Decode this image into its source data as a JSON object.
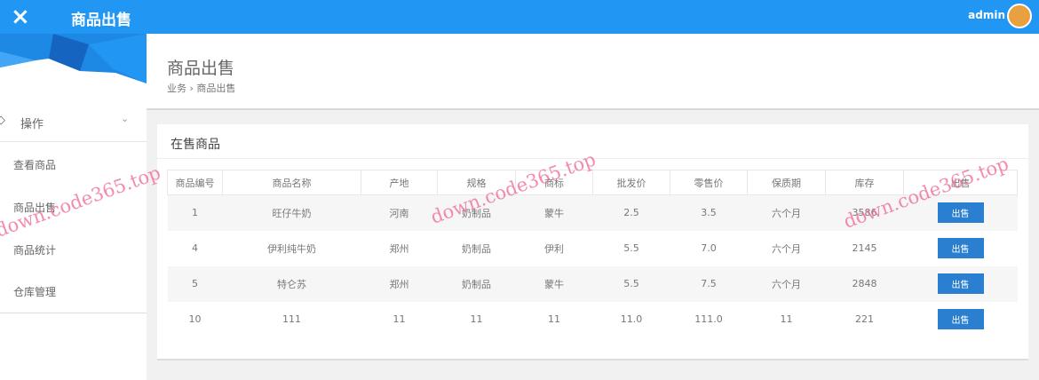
{
  "topbar": {
    "close_icon": "×",
    "title": "商品出售",
    "user": "admin"
  },
  "sidebar": {
    "menu": "操作",
    "items": [
      "查看商品",
      "商品出售",
      "商品统计",
      "仓库管理"
    ]
  },
  "header": {
    "title": "商品出售",
    "breadcrumb": "业务 › 商品出售"
  },
  "card": {
    "title": "在售商品",
    "columns": [
      "商品编号",
      "商品名称",
      "产地",
      "规格",
      "商标",
      "批发价",
      "零售价",
      "保质期",
      "库存",
      "出售"
    ],
    "rows": [
      [
        "1",
        "旺仔牛奶",
        "河南",
        "奶制品",
        "蒙牛",
        "2.5",
        "3.5",
        "六个月",
        "3586"
      ],
      [
        "4",
        "伊利纯牛奶",
        "郑州",
        "奶制品",
        "伊利",
        "5.5",
        "7.0",
        "六个月",
        "2145"
      ],
      [
        "5",
        "特仑苏",
        "郑州",
        "奶制品",
        "蒙牛",
        "5.5",
        "7.5",
        "六个月",
        "2848"
      ],
      [
        "10",
        "111",
        "11",
        "11",
        "11",
        "11.0",
        "111.0",
        "11",
        "221"
      ]
    ],
    "sell_label": "出售"
  },
  "watermark": "down.code365.top",
  "colors": {
    "primary": "#2196f3",
    "button": "#2a7fd0",
    "watermark": "#ef6f9a"
  }
}
